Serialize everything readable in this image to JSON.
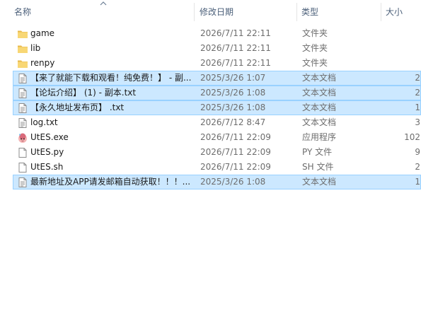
{
  "columns": {
    "name": "名称",
    "date": "修改日期",
    "type": "类型",
    "size": "大小"
  },
  "sort": {
    "column": "name",
    "direction": "ascending",
    "icon": "chevron-up-icon"
  },
  "colors": {
    "selection_bg": "#cce8ff",
    "selection_border": "#99d1ff",
    "folder": "#f8d775",
    "header_text": "#4c607a",
    "meta_text": "#6d6d6d"
  },
  "files": [
    {
      "name": "game",
      "date": "2026/7/11 22:11",
      "type": "文件夹",
      "size": "",
      "icon": "folder-icon",
      "selected": false
    },
    {
      "name": "lib",
      "date": "2026/7/11 22:11",
      "type": "文件夹",
      "size": "",
      "icon": "folder-icon",
      "selected": false
    },
    {
      "name": "renpy",
      "date": "2026/7/11 22:11",
      "type": "文件夹",
      "size": "",
      "icon": "folder-icon",
      "selected": false
    },
    {
      "name": "【来了就能下载和观看！纯免费！】 - 副...",
      "date": "2025/3/26 1:07",
      "type": "文本文档",
      "size": "2",
      "icon": "text-file-icon",
      "selected": true
    },
    {
      "name": "【论坛介绍】 (1) - 副本.txt",
      "date": "2025/3/26 1:08",
      "type": "文本文档",
      "size": "2",
      "icon": "text-file-icon",
      "selected": true
    },
    {
      "name": "【永久地址发布页】 .txt",
      "date": "2025/3/26 1:08",
      "type": "文本文档",
      "size": "1",
      "icon": "text-file-icon",
      "selected": true
    },
    {
      "name": "log.txt",
      "date": "2026/7/12 8:47",
      "type": "文本文档",
      "size": "3",
      "icon": "text-file-icon",
      "selected": false
    },
    {
      "name": "UtES.exe",
      "date": "2026/7/11 22:09",
      "type": "应用程序",
      "size": "102",
      "icon": "application-icon",
      "selected": false
    },
    {
      "name": "UtES.py",
      "date": "2026/7/11 22:09",
      "type": "PY 文件",
      "size": "9",
      "icon": "blank-file-icon",
      "selected": false
    },
    {
      "name": "UtES.sh",
      "date": "2026/7/11 22:09",
      "type": "SH 文件",
      "size": "2",
      "icon": "blank-file-icon",
      "selected": false
    },
    {
      "name": "最新地址及APP请发邮箱自动获取！！！...",
      "date": "2025/3/26 1:08",
      "type": "文本文档",
      "size": "1",
      "icon": "text-file-icon",
      "selected": true
    }
  ]
}
